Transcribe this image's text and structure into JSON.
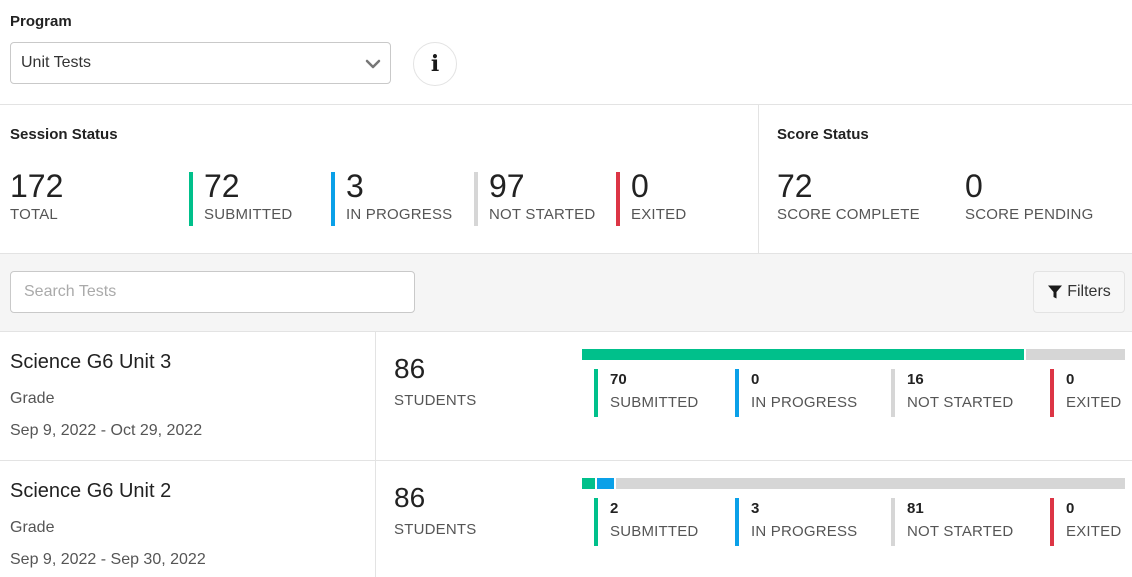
{
  "colors": {
    "submitted": "#00c08b",
    "in_progress": "#0aa0e8",
    "not_started": "#d6d6d6",
    "exited": "#dc3545"
  },
  "program": {
    "label": "Program",
    "selected": "Unit Tests",
    "dropdown_icon": "chevron-down-icon",
    "info_icon": "info-icon"
  },
  "session_status": {
    "title": "Session Status",
    "total": {
      "value": "172",
      "label": "TOTAL"
    },
    "submitted": {
      "value": "72",
      "label": "SUBMITTED"
    },
    "in_progress": {
      "value": "3",
      "label": "IN PROGRESS"
    },
    "not_started": {
      "value": "97",
      "label": "NOT STARTED"
    },
    "exited": {
      "value": "0",
      "label": "EXITED"
    }
  },
  "score_status": {
    "title": "Score Status",
    "complete": {
      "value": "72",
      "label": "SCORE COMPLETE"
    },
    "pending": {
      "value": "0",
      "label": "SCORE PENDING"
    }
  },
  "search": {
    "placeholder": "Search Tests",
    "value": ""
  },
  "filters": {
    "label": "Filters",
    "icon": "filter-icon"
  },
  "tests": [
    {
      "name": "Science G6 Unit 3",
      "grade": "Grade",
      "dates": "Sep 9, 2022 - Oct 29, 2022",
      "students": "86",
      "students_label": "STUDENTS",
      "submitted": {
        "value": "70",
        "label": "SUBMITTED"
      },
      "in_progress": {
        "value": "0",
        "label": "IN PROGRESS"
      },
      "not_started": {
        "value": "16",
        "label": "NOT STARTED"
      },
      "exited": {
        "value": "0",
        "label": "EXITED"
      },
      "counts": {
        "submitted": 70,
        "in_progress": 0,
        "not_started": 16,
        "exited": 0,
        "total": 86
      }
    },
    {
      "name": "Science G6 Unit 2",
      "grade": "Grade",
      "dates": "Sep 9, 2022 - Sep 30, 2022",
      "students": "86",
      "students_label": "STUDENTS",
      "submitted": {
        "value": "2",
        "label": "SUBMITTED"
      },
      "in_progress": {
        "value": "3",
        "label": "IN PROGRESS"
      },
      "not_started": {
        "value": "81",
        "label": "NOT STARTED"
      },
      "exited": {
        "value": "0",
        "label": "EXITED"
      },
      "counts": {
        "submitted": 2,
        "in_progress": 3,
        "not_started": 81,
        "exited": 0,
        "total": 86
      }
    }
  ]
}
